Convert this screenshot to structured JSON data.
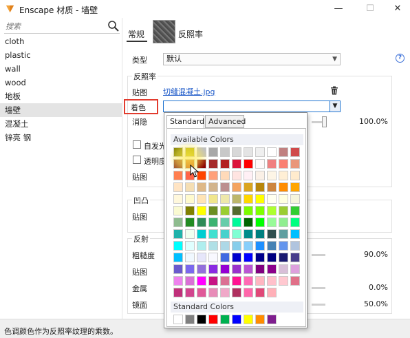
{
  "window": {
    "title": "Enscape 材质 - 墙壁",
    "minimize": "—",
    "maximize": "☐",
    "close": "✕"
  },
  "search": {
    "placeholder": "搜索"
  },
  "materials": [
    "cloth",
    "plastic",
    "wall",
    "wood",
    "地板",
    "墙壁",
    "混凝土",
    "锌亮 钢"
  ],
  "selected_material_index": 5,
  "tabs": {
    "general": "常规",
    "reflectance": "反照率"
  },
  "form": {
    "type_label": "类型",
    "type_value": "默认",
    "help": "?",
    "reflectance_section": "反照率",
    "texture_label": "贴图",
    "texture_file": "切缝混凝土.jpg",
    "tint_label": "着色",
    "fade_label": "消隐",
    "fade_value": "100.0%",
    "emissive_label": "自发光",
    "transparency_label": "透明度",
    "transparency_texture_label": "贴图",
    "bump_section": "凹凸",
    "bump_texture_label": "贴图",
    "reflection_section": "反射",
    "roughness_label": "粗糙度",
    "roughness_value": "90.0%",
    "reflection_texture_label": "贴图",
    "metallic_label": "金属",
    "metallic_value": "0.0%",
    "specular_label": "镜面",
    "specular_value": "50.0%"
  },
  "color_popup": {
    "tab_standard": "Standard",
    "tab_advanced": "Advanced",
    "available_title": "Available Colors",
    "standard_title": "Standard Colors",
    "available_colors": [
      [
        "#7f7f00",
        "#b5b000",
        "#c0c0c0",
        "#a8a8a8",
        "#c8c8c8",
        "#d8d8d8",
        "#e4e4e4",
        "#efefef",
        "#ffffff",
        "#c08080",
        "#d04a4a"
      ],
      [
        "#a0522d",
        "#d2691e",
        "#8b0000",
        "#a52a2a",
        "#b22222",
        "#dc143c",
        "#ff0000",
        "#fffafa",
        "#f08080",
        "#fa8072",
        "#e9967a"
      ],
      [
        "#ff7f50",
        "#ff6347",
        "#ff4500",
        "#ffa07a",
        "#ffdab9",
        "#ffe4e1",
        "#fff0f5",
        "#faf0e6",
        "#fdf5e6",
        "#ffefd5",
        "#ffebcd"
      ],
      [
        "#ffe4c4",
        "#f5deb3",
        "#deb887",
        "#d2b48c",
        "#bc8f8f",
        "#f4a460",
        "#daa520",
        "#b8860b",
        "#cd853f",
        "#ff8c00",
        "#ffa500"
      ],
      [
        "#fff8dc",
        "#fffacd",
        "#ffe4b5",
        "#f0e68c",
        "#eee8aa",
        "#bdb76b",
        "#ffd700",
        "#ffff00",
        "#fffff0",
        "#ffffe0",
        "#f5f5dc"
      ],
      [
        "#fafad2",
        "#808000",
        "#ffff00",
        "#6b8e23",
        "#9acd32",
        "#556b2f",
        "#7cfc00",
        "#7fff00",
        "#adff2f",
        "#9acd32",
        "#32cd32"
      ],
      [
        "#8fbc8f",
        "#228b22",
        "#2e8b57",
        "#3cb371",
        "#66cdaa",
        "#00fa9a",
        "#006400",
        "#00ff00",
        "#98fb98",
        "#90ee90",
        "#00ff7f"
      ],
      [
        "#20b2aa",
        "#f0fff0",
        "#00ced1",
        "#40e0d0",
        "#48d1cc",
        "#7fffd4",
        "#008b8b",
        "#008080",
        "#2f4f4f",
        "#5f9ea0",
        "#00bfff"
      ],
      [
        "#00ffff",
        "#e0ffff",
        "#afeeee",
        "#b0e0e6",
        "#add8e6",
        "#87ceeb",
        "#87cefa",
        "#1e90ff",
        "#4682b4",
        "#6495ed",
        "#b0c4de"
      ],
      [
        "#00bfff",
        "#f0f8ff",
        "#e6e6fa",
        "#f8f8ff",
        "#4169e1",
        "#0000cd",
        "#0000ff",
        "#00008b",
        "#000080",
        "#191970",
        "#483d8b"
      ],
      [
        "#6a5acd",
        "#7b68ee",
        "#9370db",
        "#8a2be2",
        "#9400d3",
        "#9932cc",
        "#ba55d3",
        "#800080",
        "#8b008b",
        "#d8bfd8",
        "#dda0dd"
      ],
      [
        "#ee82ee",
        "#da70d6",
        "#ff00ff",
        "#c71585",
        "#db7093",
        "#ff1493",
        "#ff69b4",
        "#ffb6c1",
        "#ffc0cb",
        "#ffc8d0",
        "#e07088"
      ],
      [
        "#c0307a",
        "#d2448e",
        "#e05898",
        "#e88cb8",
        "#f0a8c8",
        "#b03060",
        "#ff66aa",
        "#e04878",
        "#ffb0b8"
      ]
    ],
    "standard_colors": [
      "#ffffff",
      "#7f7f7f",
      "#000000",
      "#ff0000",
      "#00b050",
      "#0000ff",
      "#ffff00",
      "#ff8c00",
      "#7f1f8f"
    ]
  },
  "status": {
    "text": "色调颜色作为反照率纹理的乘数。"
  }
}
